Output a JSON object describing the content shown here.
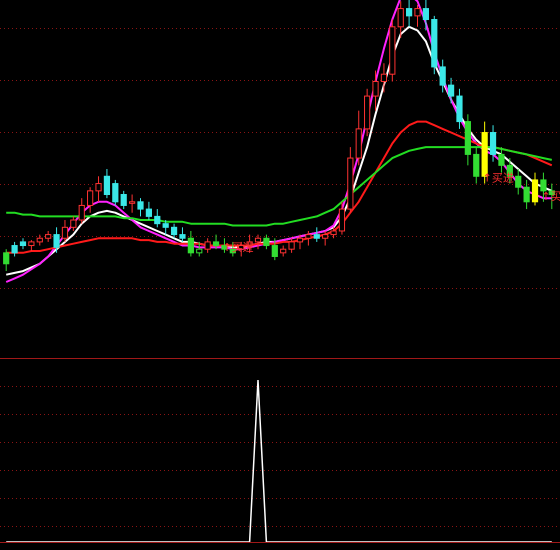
{
  "theme": {
    "background": "#000000",
    "grid": "#8a1414",
    "divider": "#a01818",
    "candle_up": "#ff3232",
    "candle_down": "#3be8e8",
    "candle_up_green": "#33dd33",
    "highlight_candle": "#ffff00",
    "signal_text": "#ff3030"
  },
  "chart_data": [
    {
      "type": "candlestick",
      "panel": "main",
      "ylim": [
        0,
        100
      ],
      "xlim": [
        0,
        80
      ],
      "candles": [
        {
          "x": 0,
          "o": 72,
          "h": 74,
          "l": 62,
          "c": 66,
          "color": "green"
        },
        {
          "x": 1,
          "o": 76,
          "h": 78,
          "l": 70,
          "c": 72,
          "color": "down"
        },
        {
          "x": 2,
          "o": 78,
          "h": 80,
          "l": 74,
          "c": 76,
          "color": "down"
        },
        {
          "x": 3,
          "o": 76,
          "h": 79,
          "l": 73,
          "c": 78,
          "color": "up"
        },
        {
          "x": 4,
          "o": 78,
          "h": 82,
          "l": 76,
          "c": 80,
          "color": "up"
        },
        {
          "x": 5,
          "o": 80,
          "h": 84,
          "l": 78,
          "c": 82,
          "color": "up"
        },
        {
          "x": 6,
          "o": 82,
          "h": 86,
          "l": 72,
          "c": 75,
          "color": "down"
        },
        {
          "x": 7,
          "o": 80,
          "h": 90,
          "l": 78,
          "c": 86,
          "color": "up"
        },
        {
          "x": 8,
          "o": 86,
          "h": 92,
          "l": 84,
          "c": 90,
          "color": "up"
        },
        {
          "x": 9,
          "o": 90,
          "h": 102,
          "l": 88,
          "c": 98,
          "color": "up"
        },
        {
          "x": 10,
          "o": 98,
          "h": 108,
          "l": 94,
          "c": 106,
          "color": "up"
        },
        {
          "x": 11,
          "o": 106,
          "h": 114,
          "l": 100,
          "c": 110,
          "color": "up"
        },
        {
          "x": 12,
          "o": 114,
          "h": 118,
          "l": 102,
          "c": 104,
          "color": "down"
        },
        {
          "x": 13,
          "o": 110,
          "h": 112,
          "l": 98,
          "c": 100,
          "color": "down"
        },
        {
          "x": 14,
          "o": 104,
          "h": 106,
          "l": 96,
          "c": 98,
          "color": "down"
        },
        {
          "x": 15,
          "o": 100,
          "h": 104,
          "l": 94,
          "c": 100,
          "color": "up"
        },
        {
          "x": 16,
          "o": 100,
          "h": 102,
          "l": 92,
          "c": 96,
          "color": "down"
        },
        {
          "x": 17,
          "o": 96,
          "h": 100,
          "l": 90,
          "c": 92,
          "color": "down"
        },
        {
          "x": 18,
          "o": 92,
          "h": 96,
          "l": 86,
          "c": 88,
          "color": "down"
        },
        {
          "x": 19,
          "o": 88,
          "h": 90,
          "l": 82,
          "c": 86,
          "color": "down"
        },
        {
          "x": 20,
          "o": 86,
          "h": 88,
          "l": 80,
          "c": 82,
          "color": "down"
        },
        {
          "x": 21,
          "o": 82,
          "h": 86,
          "l": 78,
          "c": 80,
          "color": "down"
        },
        {
          "x": 22,
          "o": 80,
          "h": 84,
          "l": 70,
          "c": 72,
          "color": "green"
        },
        {
          "x": 23,
          "o": 72,
          "h": 78,
          "l": 70,
          "c": 74,
          "color": "green"
        },
        {
          "x": 24,
          "o": 74,
          "h": 80,
          "l": 72,
          "c": 78,
          "color": "up"
        },
        {
          "x": 25,
          "o": 78,
          "h": 82,
          "l": 74,
          "c": 76,
          "color": "green"
        },
        {
          "x": 26,
          "o": 76,
          "h": 80,
          "l": 72,
          "c": 74,
          "color": "green"
        },
        {
          "x": 27,
          "o": 74,
          "h": 78,
          "l": 70,
          "c": 72,
          "color": "green"
        },
        {
          "x": 28,
          "o": 74,
          "h": 78,
          "l": 70,
          "c": 76,
          "color": "up"
        },
        {
          "x": 29,
          "o": 76,
          "h": 82,
          "l": 72,
          "c": 78,
          "color": "up"
        },
        {
          "x": 30,
          "o": 78,
          "h": 82,
          "l": 74,
          "c": 80,
          "color": "up"
        },
        {
          "x": 31,
          "o": 80,
          "h": 82,
          "l": 74,
          "c": 76,
          "color": "green"
        },
        {
          "x": 32,
          "o": 76,
          "h": 80,
          "l": 68,
          "c": 70,
          "color": "green"
        },
        {
          "x": 33,
          "o": 72,
          "h": 76,
          "l": 70,
          "c": 74,
          "color": "up"
        },
        {
          "x": 34,
          "o": 74,
          "h": 80,
          "l": 72,
          "c": 78,
          "color": "up"
        },
        {
          "x": 35,
          "o": 78,
          "h": 82,
          "l": 74,
          "c": 80,
          "color": "up"
        },
        {
          "x": 36,
          "o": 80,
          "h": 84,
          "l": 76,
          "c": 82,
          "color": "up"
        },
        {
          "x": 37,
          "o": 82,
          "h": 86,
          "l": 78,
          "c": 80,
          "color": "down"
        },
        {
          "x": 38,
          "o": 80,
          "h": 84,
          "l": 76,
          "c": 82,
          "color": "up"
        },
        {
          "x": 39,
          "o": 82,
          "h": 86,
          "l": 80,
          "c": 84,
          "color": "up"
        },
        {
          "x": 40,
          "o": 84,
          "h": 100,
          "l": 82,
          "c": 96,
          "color": "up"
        },
        {
          "x": 41,
          "o": 96,
          "h": 130,
          "l": 94,
          "c": 124,
          "color": "up"
        },
        {
          "x": 42,
          "o": 124,
          "h": 150,
          "l": 120,
          "c": 140,
          "color": "up"
        },
        {
          "x": 43,
          "o": 140,
          "h": 162,
          "l": 136,
          "c": 158,
          "color": "up"
        },
        {
          "x": 44,
          "o": 158,
          "h": 172,
          "l": 150,
          "c": 166,
          "color": "up"
        },
        {
          "x": 45,
          "o": 166,
          "h": 176,
          "l": 160,
          "c": 170,
          "color": "up"
        },
        {
          "x": 46,
          "o": 170,
          "h": 200,
          "l": 166,
          "c": 196,
          "color": "up"
        },
        {
          "x": 47,
          "o": 196,
          "h": 210,
          "l": 190,
          "c": 206,
          "color": "up"
        },
        {
          "x": 48,
          "o": 206,
          "h": 212,
          "l": 196,
          "c": 202,
          "color": "down"
        },
        {
          "x": 49,
          "o": 202,
          "h": 208,
          "l": 196,
          "c": 206,
          "color": "up"
        },
        {
          "x": 50,
          "o": 206,
          "h": 212,
          "l": 194,
          "c": 200,
          "color": "down"
        },
        {
          "x": 51,
          "o": 200,
          "h": 202,
          "l": 170,
          "c": 174,
          "color": "down"
        },
        {
          "x": 52,
          "o": 174,
          "h": 178,
          "l": 160,
          "c": 164,
          "color": "down"
        },
        {
          "x": 53,
          "o": 164,
          "h": 168,
          "l": 154,
          "c": 158,
          "color": "down"
        },
        {
          "x": 54,
          "o": 158,
          "h": 162,
          "l": 140,
          "c": 144,
          "color": "down"
        },
        {
          "x": 55,
          "o": 144,
          "h": 148,
          "l": 120,
          "c": 126,
          "color": "green"
        },
        {
          "x": 56,
          "o": 126,
          "h": 130,
          "l": 110,
          "c": 114,
          "color": "green"
        },
        {
          "x": 57,
          "o": 114,
          "h": 144,
          "l": 110,
          "c": 138,
          "color": "highlight"
        },
        {
          "x": 58,
          "o": 138,
          "h": 142,
          "l": 122,
          "c": 126,
          "color": "down"
        },
        {
          "x": 59,
          "o": 126,
          "h": 130,
          "l": 116,
          "c": 120,
          "color": "green"
        },
        {
          "x": 60,
          "o": 120,
          "h": 124,
          "l": 110,
          "c": 114,
          "color": "green"
        },
        {
          "x": 61,
          "o": 114,
          "h": 118,
          "l": 104,
          "c": 108,
          "color": "green"
        },
        {
          "x": 62,
          "o": 108,
          "h": 112,
          "l": 96,
          "c": 100,
          "color": "green"
        },
        {
          "x": 63,
          "o": 100,
          "h": 116,
          "l": 98,
          "c": 112,
          "color": "highlight"
        },
        {
          "x": 64,
          "o": 112,
          "h": 116,
          "l": 100,
          "c": 106,
          "color": "green"
        },
        {
          "x": 65,
          "o": 106,
          "h": 110,
          "l": 96,
          "c": 104,
          "color": "green"
        }
      ],
      "series": [
        {
          "color": "#ffffff",
          "values": [
            60,
            61,
            62,
            64,
            66,
            70,
            74,
            78,
            82,
            88,
            92,
            94,
            95,
            94,
            92,
            90,
            88,
            86,
            84,
            82,
            80,
            78,
            78,
            77,
            76,
            76,
            76,
            75,
            75,
            76,
            77,
            78,
            78,
            79,
            80,
            81,
            82,
            83,
            84,
            86,
            92,
            102,
            116,
            130,
            148,
            164,
            180,
            192,
            196,
            194,
            188,
            176,
            166,
            156,
            148,
            140,
            134,
            130,
            128,
            126,
            122,
            118,
            114,
            110,
            108,
            106
          ]
        },
        {
          "color": "#ff22ff",
          "values": [
            56,
            58,
            60,
            63,
            66,
            70,
            76,
            82,
            88,
            94,
            98,
            100,
            100,
            98,
            94,
            90,
            86,
            84,
            82,
            80,
            78,
            76,
            76,
            75,
            75,
            75,
            75,
            74,
            74,
            75,
            76,
            77,
            78,
            79,
            80,
            81,
            82,
            83,
            84,
            87,
            96,
            110,
            126,
            146,
            166,
            184,
            200,
            212,
            214,
            210,
            198,
            182,
            168,
            156,
            146,
            138,
            132,
            128,
            126,
            122,
            116,
            110,
            106,
            104,
            102,
            102
          ]
        },
        {
          "color": "#ff1a1a",
          "values": [
            72,
            72,
            72,
            73,
            73,
            74,
            75,
            76,
            77,
            78,
            79,
            80,
            80,
            80,
            80,
            80,
            79,
            79,
            78,
            78,
            77,
            77,
            77,
            77,
            76,
            76,
            76,
            76,
            76,
            76,
            77,
            77,
            77,
            78,
            78,
            79,
            80,
            81,
            82,
            84,
            88,
            94,
            100,
            108,
            116,
            124,
            132,
            138,
            142,
            144,
            144,
            142,
            140,
            138,
            136,
            134,
            132,
            130,
            130,
            129,
            128,
            127,
            126,
            124,
            122,
            120
          ]
        },
        {
          "color": "#22dd22",
          "values": [
            94,
            94,
            93,
            93,
            92,
            92,
            92,
            92,
            92,
            92,
            92,
            92,
            92,
            92,
            91,
            91,
            90,
            90,
            90,
            89,
            89,
            89,
            88,
            88,
            88,
            88,
            88,
            87,
            87,
            87,
            87,
            87,
            88,
            88,
            89,
            90,
            91,
            92,
            94,
            96,
            100,
            104,
            108,
            112,
            116,
            120,
            124,
            126,
            128,
            129,
            130,
            130,
            130,
            130,
            130,
            130,
            130,
            130,
            130,
            129,
            128,
            127,
            126,
            125,
            124,
            123
          ]
        }
      ],
      "signals": [
        {
          "x": 26,
          "text": "买进"
        },
        {
          "x": 57,
          "text": "买进"
        },
        {
          "x": 64,
          "text": "买进"
        }
      ]
    },
    {
      "type": "line",
      "panel": "indicator",
      "ylim": [
        0,
        1
      ],
      "x": [
        0,
        1,
        2,
        3,
        4,
        5,
        6,
        7,
        8,
        9,
        10,
        11,
        12,
        13,
        14,
        15,
        16,
        17,
        18,
        19,
        20,
        21,
        22,
        23,
        24,
        25,
        26,
        27,
        28,
        29,
        30,
        31,
        32,
        33,
        34,
        35,
        36,
        37,
        38,
        39,
        40,
        41,
        42,
        43,
        44,
        45,
        46,
        47,
        48,
        49,
        50,
        51,
        52,
        53,
        54,
        55,
        56,
        57,
        58,
        59,
        60,
        61,
        62,
        63,
        64,
        65
      ],
      "values": [
        0,
        0,
        0,
        0,
        0,
        0,
        0,
        0,
        0,
        0,
        0,
        0,
        0,
        0,
        0,
        0,
        0,
        0,
        0,
        0,
        0,
        0,
        0,
        0,
        0,
        0,
        0,
        0,
        0,
        0,
        1,
        0,
        0,
        0,
        0,
        0,
        0,
        0,
        0,
        0,
        0,
        0,
        0,
        0,
        0,
        0,
        0,
        0,
        0,
        0,
        0,
        0,
        0,
        0,
        0,
        0,
        0,
        0,
        0,
        0,
        0,
        0,
        0,
        0,
        0,
        0
      ],
      "color": "#ffffff"
    }
  ]
}
